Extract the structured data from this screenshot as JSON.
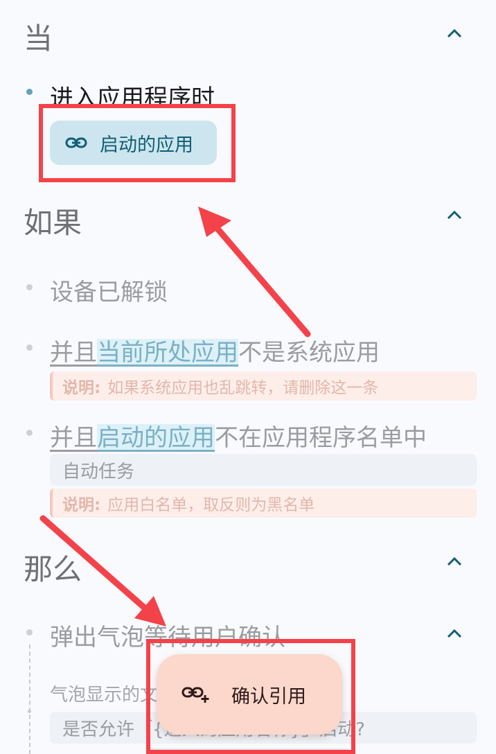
{
  "when": {
    "title": "当",
    "trigger": "进入应用程序时",
    "chip_label": "启动的应用"
  },
  "if": {
    "title": "如果",
    "cond1": "设备已解锁",
    "cond2": {
      "prefix": "并且",
      "highlight": "当前所处应用",
      "suffix": "不是系统应用"
    },
    "note1": {
      "label": "说明:",
      "text": "如果系统应用也乱跳转，请删除这一条"
    },
    "cond3": {
      "prefix": "并且",
      "highlight": "启动的应用",
      "suffix": "不在应用程序名单中"
    },
    "cond3_value": "自动任务",
    "note2": {
      "label": "说明:",
      "text": "应用白名单，取反则为黑名单"
    }
  },
  "then": {
    "title": "那么",
    "action": "弹出气泡等待用户确认",
    "sub_label": "气泡显示的文字",
    "text_value": "是否允许「{进入的应用名称}」启动?"
  },
  "fab": {
    "label": "确认引用"
  },
  "colors": {
    "accent": "#0f5e74",
    "annotation_red": "#f4424a",
    "fab_bg": "#fbd8cb"
  }
}
